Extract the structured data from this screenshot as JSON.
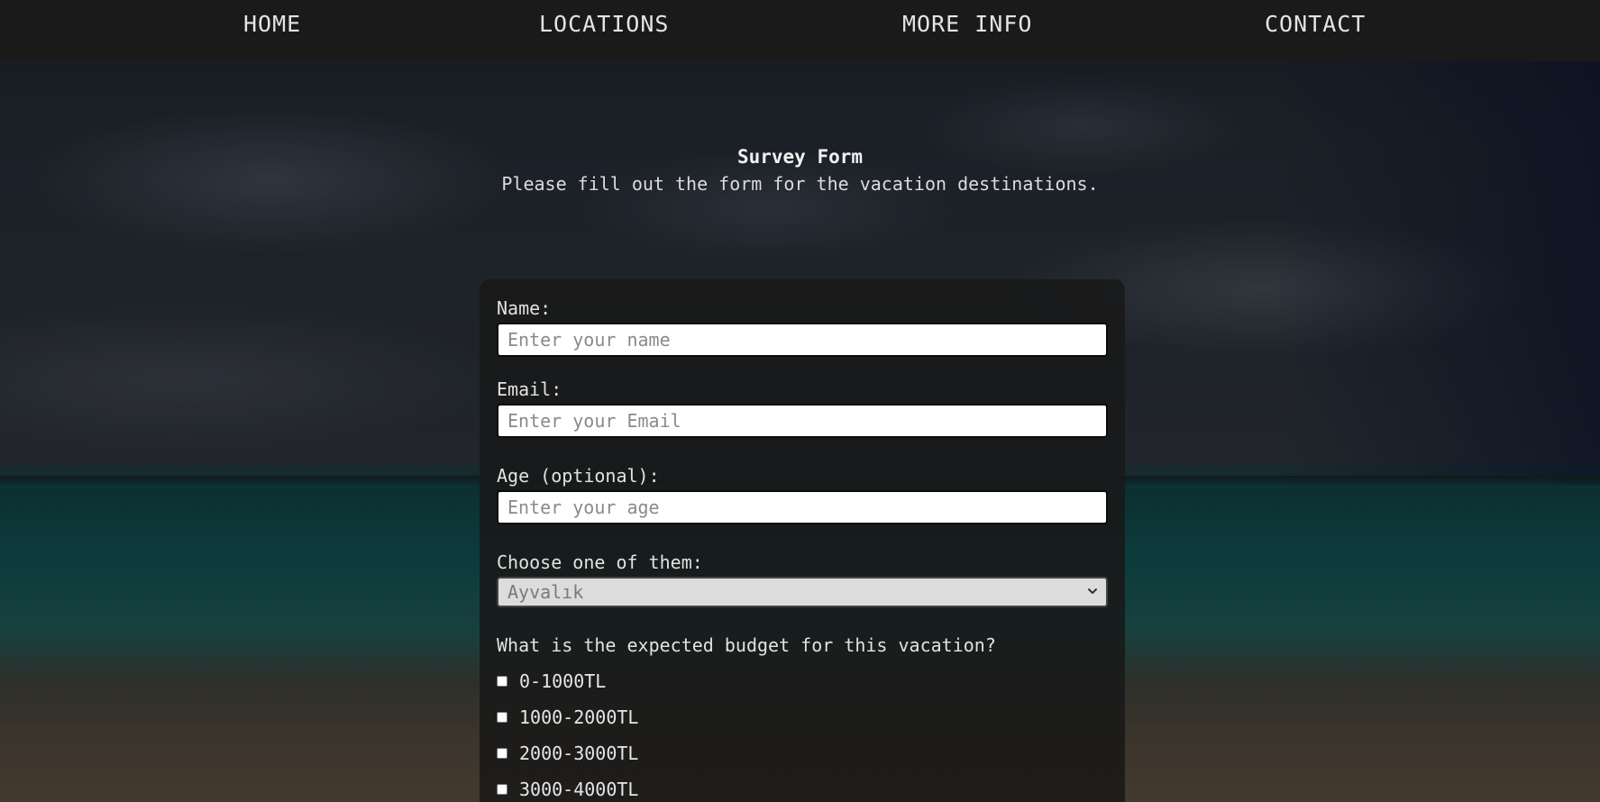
{
  "nav": {
    "home": "HOME",
    "locations": "LOCATIONS",
    "more_info": "MORE INFO",
    "contact": "CONTACT"
  },
  "header": {
    "title": "Survey Form",
    "subtitle": "Please fill out the form for the vacation destinations."
  },
  "form": {
    "name": {
      "label": "Name:",
      "placeholder": "Enter your name",
      "value": ""
    },
    "email": {
      "label": "Email:",
      "placeholder": "Enter your Email",
      "value": ""
    },
    "age": {
      "label": "Age (optional):",
      "placeholder": "Enter your age",
      "value": ""
    },
    "choice": {
      "label": "Choose one of them:",
      "selected": "Ayvalık"
    },
    "budget": {
      "question": "What is the expected budget for this vacation?",
      "options": [
        "0-1000TL",
        "1000-2000TL",
        "2000-3000TL",
        "3000-4000TL"
      ]
    }
  },
  "colors": {
    "navbar": "#1a1a1a",
    "panel": "#181818",
    "text": "#e2e2e2"
  },
  "icons": {
    "select": "chevron-down-icon"
  }
}
